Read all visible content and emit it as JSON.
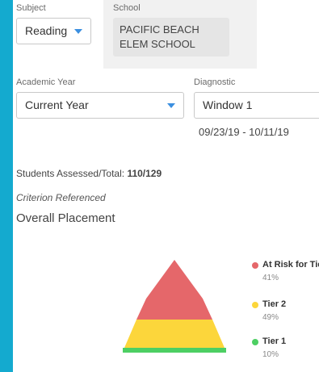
{
  "filters": {
    "subject": {
      "label": "Subject",
      "value": "Reading"
    },
    "school": {
      "label": "School",
      "value": "PACIFIC BEACH ELEM SCHOOL"
    },
    "academic_year": {
      "label": "Academic Year",
      "value": "Current Year"
    },
    "diagnostic": {
      "label": "Diagnostic",
      "value": "Window 1",
      "date_range": "09/23/19 - 10/11/19"
    }
  },
  "summary": {
    "students_label": "Students Assessed/Total:",
    "students_value": "110/129",
    "criterion": "Criterion Referenced",
    "heading": "Overall Placement"
  },
  "placement": [
    {
      "name": "At Risk for Tier",
      "percent": "41%",
      "value": 41,
      "color": "#e5676a"
    },
    {
      "name": "Tier 2",
      "percent": "49%",
      "value": 49,
      "color": "#fcd63b"
    },
    {
      "name": "Tier 1",
      "percent": "10%",
      "value": 10,
      "color": "#4dcf63"
    }
  ],
  "colors": {
    "accent": "#3b8fe0",
    "frame": "#14aacf"
  }
}
